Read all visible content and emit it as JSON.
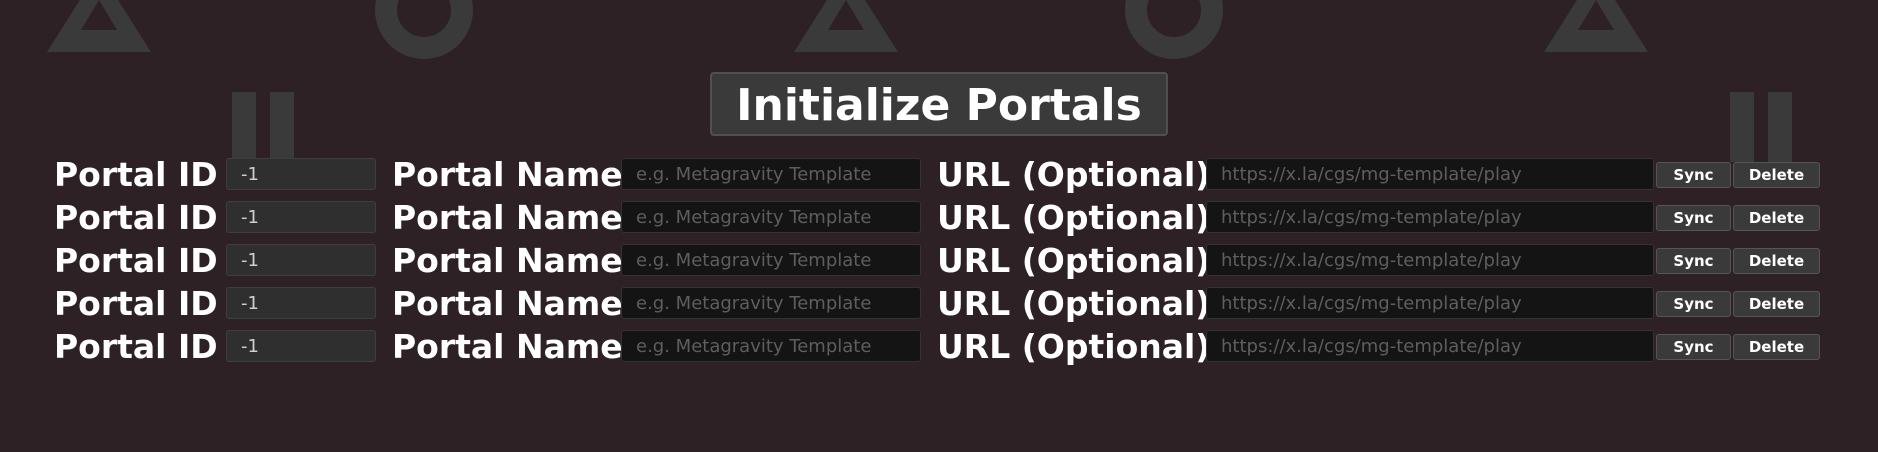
{
  "page": {
    "title": "Initialize Portals",
    "background_color": "#2d2126",
    "background_pattern_color": "#3a3a3a",
    "background_icons": [
      "triangle-icon",
      "circle-icon",
      "pause-icon"
    ]
  },
  "labels": {
    "portal_id": "Portal ID :",
    "portal_name": "Portal Name :",
    "url": "URL (Optional) :"
  },
  "placeholders": {
    "portal_name": "e.g. Metagravity Template",
    "url": "https://x.la/cgs/mg-template/play"
  },
  "buttons": {
    "sync": "Sync",
    "delete": "Delete"
  },
  "rows": [
    {
      "portal_id": "-1",
      "portal_name": "",
      "url": ""
    },
    {
      "portal_id": "-1",
      "portal_name": "",
      "url": ""
    },
    {
      "portal_id": "-1",
      "portal_name": "",
      "url": ""
    },
    {
      "portal_id": "-1",
      "portal_name": "",
      "url": ""
    },
    {
      "portal_id": "-1",
      "portal_name": "",
      "url": ""
    }
  ]
}
